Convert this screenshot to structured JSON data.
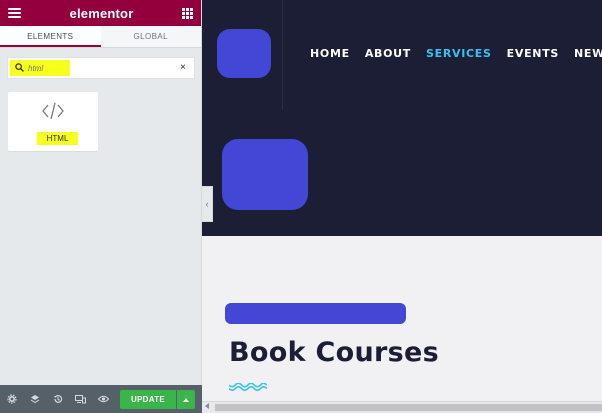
{
  "panel": {
    "brand": "elementor",
    "tabs": [
      {
        "label": "ELEMENTS",
        "active": true
      },
      {
        "label": "GLOBAL",
        "active": false
      }
    ],
    "search": {
      "value": "html",
      "clear": "×"
    },
    "widgets": [
      {
        "label": "HTML",
        "icon": "code-icon"
      }
    ],
    "footer": {
      "icons": [
        "gear-icon",
        "layers-icon",
        "history-icon",
        "responsive-icon",
        "eye-icon"
      ],
      "update_label": "UPDATE"
    },
    "colors": {
      "header": "#93003c",
      "update": "#39b54a",
      "highlight": "#f6ff1e"
    }
  },
  "preview": {
    "nav": [
      {
        "label": "HOME",
        "active": false
      },
      {
        "label": "ABOUT",
        "active": false
      },
      {
        "label": "SERVICES",
        "active": true
      },
      {
        "label": "EVENTS",
        "active": false
      },
      {
        "label": "NEWS",
        "active": false
      }
    ],
    "heading": "Book Courses",
    "colors": {
      "hero_bg": "#1c1e36",
      "accent": "#34c2ee",
      "redaction": "#4247d5"
    }
  }
}
